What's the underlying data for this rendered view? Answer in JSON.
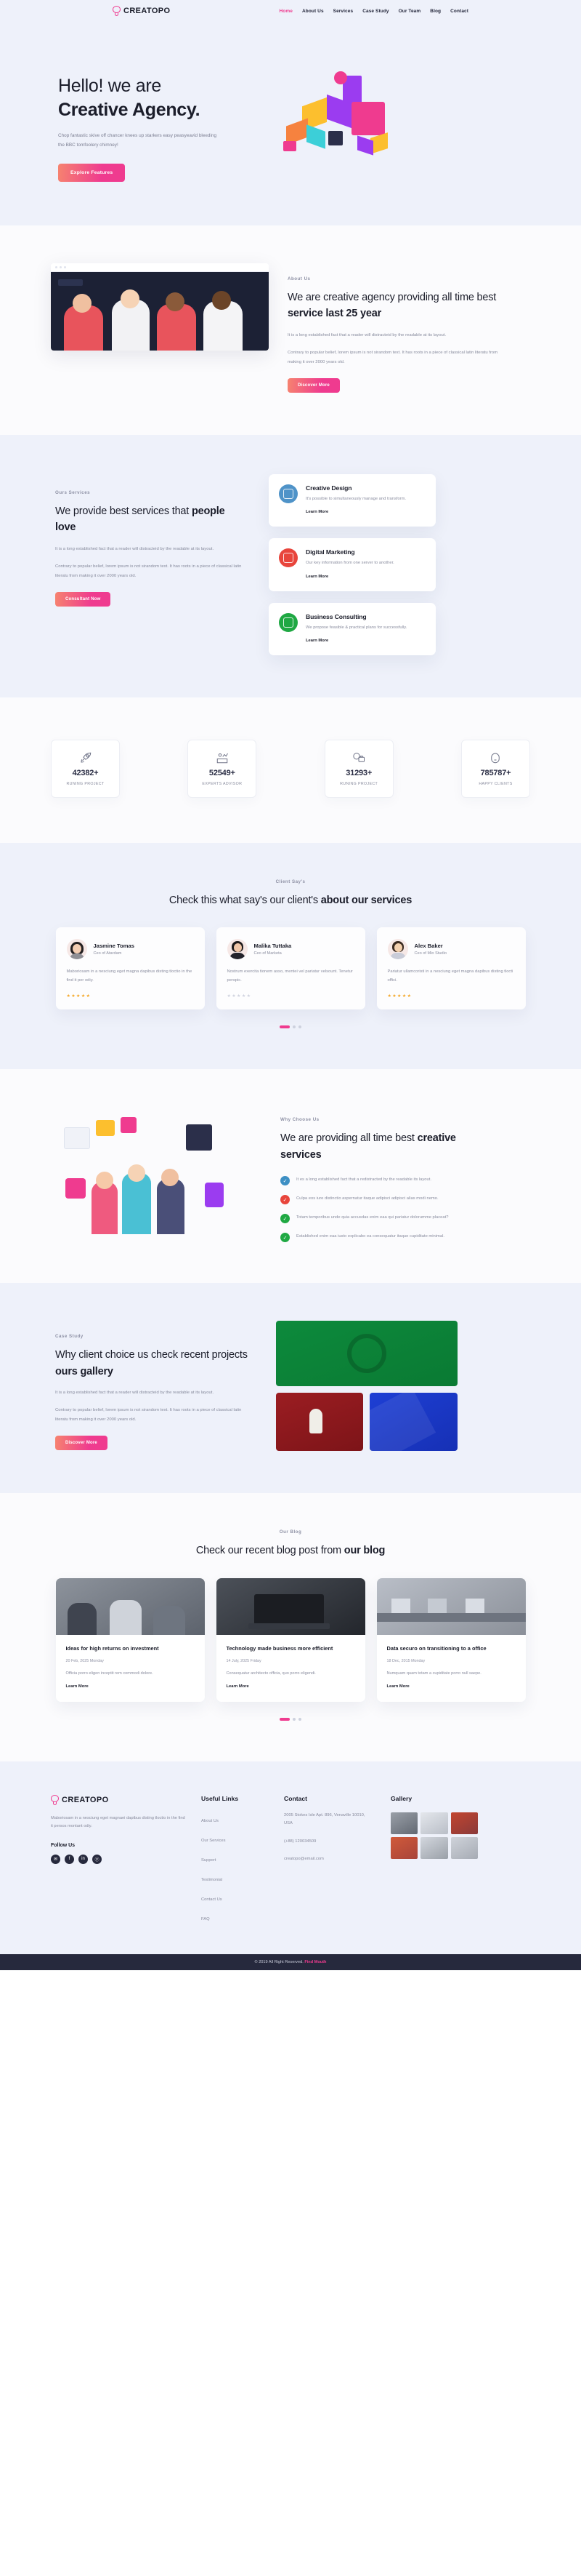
{
  "brand": {
    "name": "CREATOPO",
    "accent": "#ef3b8f"
  },
  "nav": {
    "items": [
      {
        "label": "Home",
        "active": true
      },
      {
        "label": "About Us",
        "active": false
      },
      {
        "label": "Services",
        "active": false
      },
      {
        "label": "Case Study",
        "active": false
      },
      {
        "label": "Our Team",
        "active": false
      },
      {
        "label": "Blog",
        "active": false
      },
      {
        "label": "Contact",
        "active": false
      }
    ]
  },
  "hero": {
    "line1": "Hello! we are",
    "line2": "Creative Agency.",
    "paragraph": "Chop fantastic skive off chancer knees up starkers easy peasyeavid bleeding the BBC tomfoolery chimney!",
    "cta": "Explore Features"
  },
  "about": {
    "tag": "About Us",
    "h_light": "We are creative agency providing all time best",
    "h_bold": "service last 25 year",
    "p1": "It is a long established fact that a reader will distracteid by the readable at its layout.",
    "p2": "Contrary to popular belief, lorem ipsum is not sirandom text. It has roots in a piece of classical latin literatu from making it over 2000 years old.",
    "cta": "Discover More"
  },
  "services": {
    "tag": "Ours Services",
    "h_light": "We provide best services that ",
    "h_bold": "people love",
    "p1": "It is a long established fact that a reader will distracteid by the readable at its layout.",
    "p2": "Contrary to popular belief, lorem ipsum is not sirandom text. It has roots in a piece of classical latin literatu from making it over 2000 years old.",
    "cta": "Consultant Now",
    "cards": [
      {
        "title": "Creative Design",
        "desc": "It's possible to simultaneously manage and transform.",
        "link": "Learn More",
        "icon": "design-icon",
        "color": "#4f93c8"
      },
      {
        "title": "Digital Marketing",
        "desc": "Our key information from one server to another.",
        "link": "Learn More",
        "icon": "marketing-icon",
        "color": "#e8453c"
      },
      {
        "title": "Business Consulting",
        "desc": "We propose feasible & practical plans for successfully.",
        "link": "Learn More",
        "icon": "consulting-icon",
        "color": "#1fa843"
      }
    ]
  },
  "stats": [
    {
      "number": "42382+",
      "label": "RUNING PROJECT",
      "icon": "rocket-icon"
    },
    {
      "number": "52549+",
      "label": "EXPERTS ADVISOR",
      "icon": "desk-icon"
    },
    {
      "number": "31293+",
      "label": "RUNING PROJECT",
      "icon": "briefcase-icon"
    },
    {
      "number": "785787+",
      "label": "HAPPY CLIENTS",
      "icon": "person-icon"
    }
  ],
  "testimonials": {
    "tag": "Client Say's",
    "h_light": "Check this what say's our client's",
    "h_bold": "about our services",
    "cards": [
      {
        "name": "Jasmine Tomas",
        "role": "Ceo of Atardam",
        "text": "Maboriosam in a nesciung eget magna dapibus disting tloctio in the find it per odiy.",
        "stars": "★★★★★",
        "stars_color": "#f5a623"
      },
      {
        "name": "Malika Tuttaka",
        "role": "Ceo of Marketa",
        "text": "Nostrum exercita tionem asso, mentei vel pariatur velsount. Tenetur perspic.",
        "stars": "★★★★★",
        "stars_color": "#cfd2de"
      },
      {
        "name": "Alex Baker",
        "role": "Ceo of Mio Studio",
        "text": "Pariatur ullamcoristi in a nesciung eget magna dapibus disting tlocti offici.",
        "stars": "★★★★★",
        "stars_color": "#f5a623"
      }
    ]
  },
  "why": {
    "tag": "Why Choose Us",
    "h_light": "We are providing all time best ",
    "h_bold": "creative services",
    "items": [
      {
        "text": "It es a long established fact that a redistracted by the readable its layout.",
        "color": "#3d8fc4"
      },
      {
        "text": "Culpa eos iure distinctio aspernatur itaque adipisci adipisci alias modi nemo.",
        "color": "#e8453c"
      },
      {
        "text": "Totam temporibus unde quia accusdas enim eaa qui pariatur dolorumme placeat?",
        "color": "#1fa843"
      },
      {
        "text": "Established enim eaa iusto explicabo ea consequatur itaque cupiditate minimal.",
        "color": "#1fa843"
      }
    ]
  },
  "case": {
    "tag": "Case Study",
    "h_light": "Why client choice us check recent projects",
    "h_bold": "ours gallery",
    "p1": "It is a long established fact that a reader will distracteid by the readable at its layout.",
    "p2": "Contrary to popular belief, lorem ipsum is not sirandom text. It has roots in a piece of classical latin literatu from making it over 2000 years old.",
    "cta": "Discover More"
  },
  "blog": {
    "tag": "Our Blog",
    "h_light": "Check our recent blog post from",
    "h_bold": "our blog",
    "cards": [
      {
        "title": "Ideas for high returns on investment",
        "meta": "20 Feb, 2025 Monday",
        "desc": "Officia porro eligen inceptit rem commodi dolore.",
        "link": "Learn More",
        "img": "office-meeting-photo"
      },
      {
        "title": "Technology made business more efficient",
        "meta": "14 July, 2025 Friday",
        "desc": "Consequatur architecto officia, quo porro eligendi.",
        "link": "Learn More",
        "img": "laptop-desk-photo"
      },
      {
        "title": "Data securo on transitioning to a office",
        "meta": "18 Dec, 2015 Monday",
        "desc": "Numquam quam totam a cupiditate porro null saepe.",
        "link": "Learn More",
        "img": "open-office-photo"
      }
    ]
  },
  "footer": {
    "brand": "CREATOPO",
    "about": "Maboriosam in a nesciung eget magnaei dapibus disting tloctio in the find it persos montant odiy.",
    "follow_label": "Follow Us",
    "socials": [
      {
        "name": "twitter-icon",
        "glyph": "✉"
      },
      {
        "name": "facebook-icon",
        "glyph": "f"
      },
      {
        "name": "linkedin-icon",
        "glyph": "in"
      },
      {
        "name": "pinterest-icon",
        "glyph": "ⓟ"
      }
    ],
    "useful": {
      "title": "Useful Links",
      "links": [
        "About Us",
        "Our Services",
        "Support",
        "Testimonial",
        "Contact Us",
        "FAQ"
      ]
    },
    "contact": {
      "title": "Contact",
      "address": "2005 Stokes Isle Apt. 896, Venaville 10010, USA",
      "phone": "(+88) 120034509",
      "email": "creatopo@email.com"
    },
    "gallery": {
      "title": "Gallery",
      "count": 6
    },
    "copyright_pre": "© 2019 All Right Reserved.",
    "copyright_brand": "Find Mouth"
  }
}
